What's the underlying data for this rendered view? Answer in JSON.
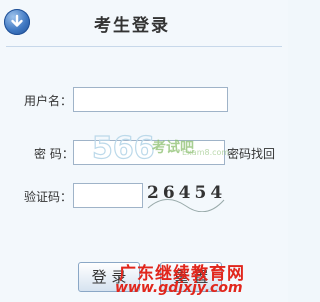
{
  "header": {
    "title": "考生登录",
    "icon": "down-arrow-circle-icon"
  },
  "form": {
    "username": {
      "label": "用户名：",
      "value": ""
    },
    "password": {
      "label": "密 码：",
      "value": "",
      "recover_link": "密码找回"
    },
    "captcha": {
      "label": "验证码：",
      "value": "",
      "code": "26454"
    }
  },
  "buttons": {
    "login": "登 录",
    "reset": "重 置"
  },
  "watermarks": {
    "logo_digits": "566",
    "logo_text": "考试吧",
    "logo_url": "Exam8.com",
    "site_name": "广东继续教育网",
    "site_url": "www.gdjxjy.com"
  },
  "colors": {
    "accent": "#3f78c2",
    "watermark_red": "#e1261c",
    "watermark_green": "#8bbf6e"
  }
}
